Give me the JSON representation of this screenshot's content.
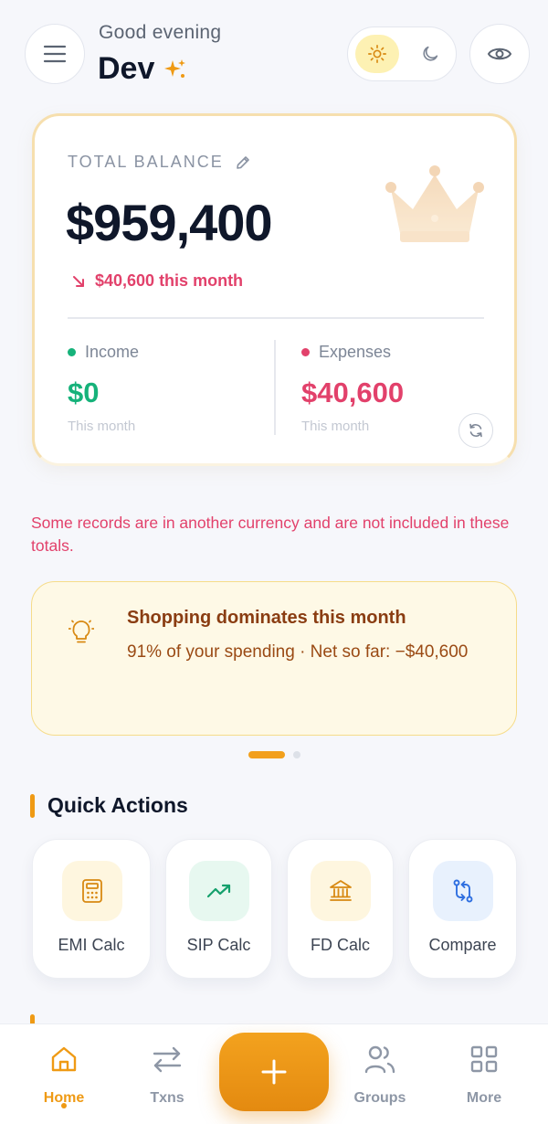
{
  "header": {
    "greeting": "Good evening",
    "username": "Dev",
    "icons": {
      "menu": "menu-icon",
      "sparkle": "sparkle-icon",
      "sun": "sun-icon",
      "moon": "moon-icon",
      "eye": "eye-icon"
    },
    "theme_selected": "light"
  },
  "balance": {
    "label": "TOTAL BALANCE",
    "amount": "$959,400",
    "change": "$40,600 this month",
    "income": {
      "label": "Income",
      "value": "$0",
      "period": "This month",
      "color": "#16b27a"
    },
    "expenses": {
      "label": "Expenses",
      "value": "$40,600",
      "period": "This month",
      "color": "#e2416b"
    }
  },
  "warning": "Some records are in another currency and are not included in these totals.",
  "insight": {
    "title": "Shopping dominates this month",
    "description": "91% of your spending · Net so far: −$40,600",
    "page_index": 1,
    "page_count": 2
  },
  "quick_actions": {
    "title": "Quick Actions",
    "items": [
      {
        "label": "EMI Calc",
        "icon": "calculator-icon",
        "bg": "#fef6df",
        "color": "#d88912"
      },
      {
        "label": "SIP Calc",
        "icon": "trending-up-icon",
        "bg": "#e7f8f0",
        "color": "#14a06c"
      },
      {
        "label": "FD Calc",
        "icon": "bank-icon",
        "bg": "#fef6df",
        "color": "#d88912"
      },
      {
        "label": "Compare",
        "icon": "compare-arrows-icon",
        "bg": "#e8f1fd",
        "color": "#2f6fe0"
      }
    ]
  },
  "bottom_nav": {
    "items": [
      {
        "label": "Home",
        "icon": "home-icon",
        "active": true
      },
      {
        "label": "Txns",
        "icon": "swap-icon",
        "active": false
      },
      {
        "label": "Groups",
        "icon": "users-icon",
        "active": false
      },
      {
        "label": "More",
        "icon": "grid-icon",
        "active": false
      }
    ],
    "fab_icon": "plus-icon"
  },
  "colors": {
    "accent": "#ef9a14",
    "danger": "#e2416b",
    "success": "#16b27a"
  }
}
